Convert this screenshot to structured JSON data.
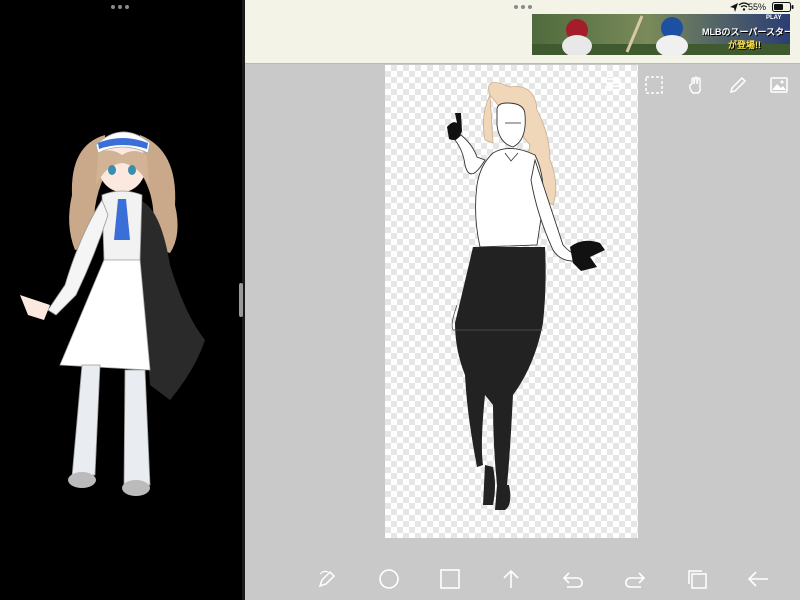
{
  "status_bar": {
    "battery": "55%"
  },
  "ad": {
    "text": "MLBのスーパースター",
    "subtext": "が登場!!",
    "tag": "PLAY"
  },
  "colors": {
    "left_bg": "#000000",
    "right_bg": "#c9c9c9",
    "top_bg": "#f4f3e7",
    "icon": "#ffffff",
    "accent_blue": "#3b6fd8"
  },
  "canvas_tools": [
    {
      "name": "layers-icon"
    },
    {
      "name": "selection-icon"
    },
    {
      "name": "hand-tool-icon"
    },
    {
      "name": "pencil-icon"
    },
    {
      "name": "image-icon"
    }
  ],
  "bottom_tools": [
    {
      "name": "transform-icon"
    },
    {
      "name": "circle-shape-icon"
    },
    {
      "name": "square-shape-icon"
    },
    {
      "name": "share-arrow-icon"
    },
    {
      "name": "undo-icon"
    },
    {
      "name": "redo-icon"
    },
    {
      "name": "copy-icon"
    },
    {
      "name": "back-arrow-icon"
    }
  ]
}
